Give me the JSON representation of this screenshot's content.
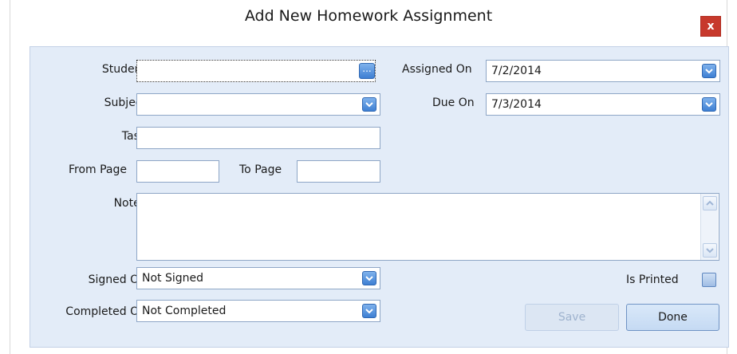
{
  "window": {
    "title": "Add New Homework Assignment",
    "close_label": "x"
  },
  "form": {
    "student": {
      "label": "Student",
      "value": "",
      "browse_label": "..."
    },
    "subject": {
      "label": "Subject",
      "value": ""
    },
    "task": {
      "label": "Task",
      "value": ""
    },
    "from_page": {
      "label": "From Page",
      "value": ""
    },
    "to_page": {
      "label": "To Page",
      "value": ""
    },
    "notes": {
      "label": "Notes",
      "value": ""
    },
    "signed_on": {
      "label": "Signed On",
      "value": "Not Signed"
    },
    "completed_on": {
      "label": "Completed On",
      "value": "Not Completed"
    },
    "assigned_on": {
      "label": "Assigned On",
      "value": "7/2/2014"
    },
    "due_on": {
      "label": "Due On",
      "value": "7/3/2014"
    },
    "is_printed": {
      "label": "Is Printed",
      "checked": false
    }
  },
  "buttons": {
    "save_label": "Save",
    "done_label": "Done"
  },
  "colors": {
    "panel_bg": "#e3ecf8",
    "accent": "#3e7fd3",
    "close_bg": "#c7392c"
  }
}
